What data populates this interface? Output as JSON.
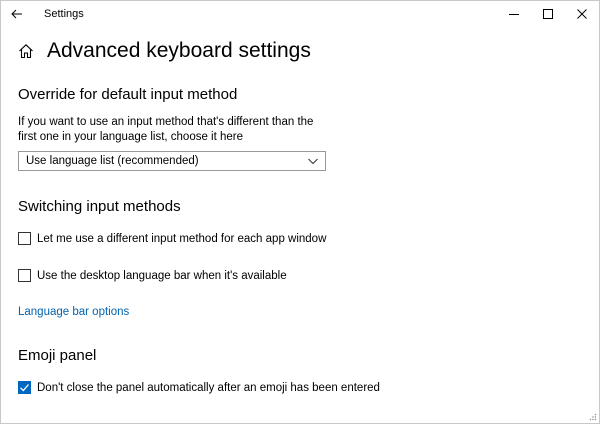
{
  "window": {
    "title": "Settings",
    "controls": {
      "minimize": "minimize-icon",
      "maximize": "maximize-icon",
      "close": "close-icon"
    }
  },
  "header": {
    "title": "Advanced keyboard settings",
    "home_icon": "home-icon",
    "back_icon": "back-arrow-icon"
  },
  "override": {
    "heading": "Override for default input method",
    "description": "If you want to use an input method that's different than the first one in your language list, choose it here",
    "dropdown_value": "Use language list (recommended)"
  },
  "switching": {
    "heading": "Switching input methods",
    "options": [
      {
        "label": "Let me use a different input method for each app window",
        "checked": false
      },
      {
        "label": "Use the desktop language bar when it's available",
        "checked": false
      }
    ],
    "link": "Language bar options"
  },
  "emoji": {
    "heading": "Emoji panel",
    "options": [
      {
        "label": "Don't close the panel automatically after an emoji has been entered",
        "checked": true
      }
    ]
  },
  "colors": {
    "accent": "#0067c0",
    "link": "#0063b1"
  }
}
